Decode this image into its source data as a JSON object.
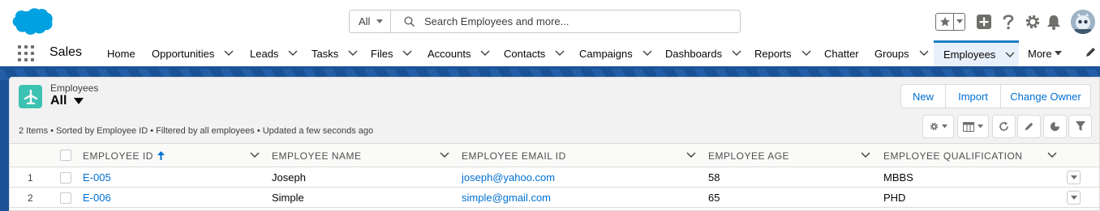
{
  "search": {
    "scope": "All",
    "placeholder": "Search Employees and more..."
  },
  "app_name": "Sales",
  "nav": {
    "items": [
      {
        "label": "Home"
      },
      {
        "label": "Opportunities"
      },
      {
        "label": "Leads"
      },
      {
        "label": "Tasks"
      },
      {
        "label": "Files"
      },
      {
        "label": "Accounts"
      },
      {
        "label": "Contacts"
      },
      {
        "label": "Campaigns"
      },
      {
        "label": "Dashboards"
      },
      {
        "label": "Reports"
      },
      {
        "label": "Chatter"
      },
      {
        "label": "Groups"
      },
      {
        "label": "Employees"
      },
      {
        "label": "More"
      }
    ],
    "active": "Employees"
  },
  "list": {
    "object_label": "Employees",
    "view_name": "All",
    "buttons": {
      "new": "New",
      "import": "Import",
      "change_owner": "Change Owner"
    },
    "status": "2 Items • Sorted by Employee ID • Filtered by all employees • Updated a few seconds ago",
    "columns": [
      "EMPLOYEE ID",
      "EMPLOYEE NAME",
      "EMPLOYEE EMAIL ID",
      "EMPLOYEE AGE",
      "EMPLOYEE QUALIFICATION"
    ],
    "sorted_column": "EMPLOYEE ID",
    "rows": [
      {
        "num": "1",
        "id": "E-005",
        "name": "Joseph",
        "email": "joseph@yahoo.com",
        "age": "58",
        "qualification": "MBBS"
      },
      {
        "num": "2",
        "id": "E-006",
        "name": "Simple",
        "email": "simple@gmail.com",
        "age": "65",
        "qualification": "PHD"
      }
    ]
  },
  "colors": {
    "brand_blue": "#1b5297",
    "link": "#0070d2",
    "object_icon": "#3cc2b3",
    "salesforce_cloud": "#00a1e0"
  }
}
